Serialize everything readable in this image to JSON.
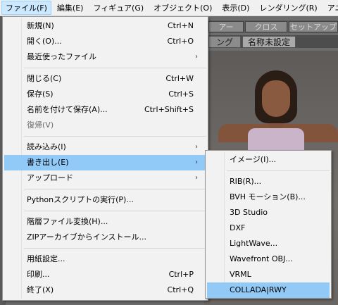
{
  "menubar": {
    "items": [
      {
        "label": "ファイル(F)",
        "active": true
      },
      {
        "label": "編集(E)"
      },
      {
        "label": "フィギュア(G)"
      },
      {
        "label": "オブジェクト(O)"
      },
      {
        "label": "表示(D)"
      },
      {
        "label": "レンダリング(R)"
      },
      {
        "label": "アニメーション(A"
      }
    ]
  },
  "background": {
    "toolbar_buttons": [
      "アー",
      "クロス",
      "セットアップ"
    ],
    "tabs": [
      "ング",
      "名称未設定"
    ]
  },
  "file_menu": {
    "items": [
      {
        "label": "新規(N)",
        "shortcut": "Ctrl+N"
      },
      {
        "label": "開く(O)...",
        "shortcut": "Ctrl+O"
      },
      {
        "label": "最近使ったファイル",
        "submenu": "›"
      },
      {
        "label": "閉じる(C)",
        "shortcut": "Ctrl+W"
      },
      {
        "label": "保存(S)",
        "shortcut": "Ctrl+S"
      },
      {
        "label": "名前を付けて保存(A)...",
        "shortcut": "Ctrl+Shift+S"
      },
      {
        "label": "復帰(V)",
        "disabled": true
      },
      {
        "label": "読み込み(I)",
        "submenu": "›"
      },
      {
        "label": "書き出し(E)",
        "submenu": "›",
        "highlighted": true
      },
      {
        "label": "アップロード",
        "submenu": "›"
      },
      {
        "label": "Pythonスクリプトの実行(P)..."
      },
      {
        "label": "階層ファイル変換(H)..."
      },
      {
        "label": "ZIPアーカイブからインストール..."
      },
      {
        "label": "用紙設定..."
      },
      {
        "label": "印刷...",
        "shortcut": "Ctrl+P"
      },
      {
        "label": "終了(X)",
        "shortcut": "Ctrl+Q"
      }
    ]
  },
  "export_menu": {
    "items": [
      {
        "label": "イメージ(I)..."
      },
      {
        "label": "RIB(R)..."
      },
      {
        "label": "BVH モーション(B)..."
      },
      {
        "label": "3D Studio"
      },
      {
        "label": "DXF"
      },
      {
        "label": "LightWave..."
      },
      {
        "label": "Wavefront OBJ..."
      },
      {
        "label": "VRML"
      },
      {
        "label": "COLLADA|RWY",
        "highlighted": true
      }
    ]
  },
  "colors": {
    "highlight": "#91c9f7",
    "menu_bg": "#f2f2f2",
    "menubar_active": "#cce8ff"
  }
}
